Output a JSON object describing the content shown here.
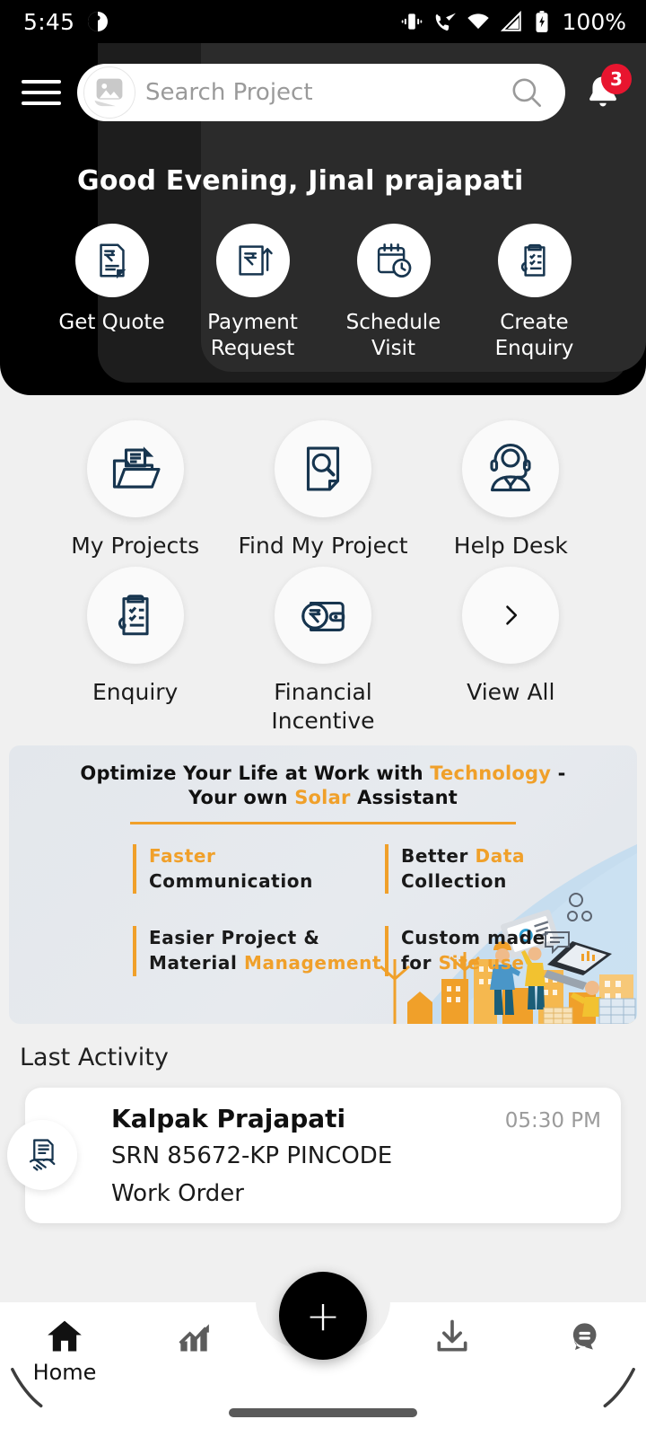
{
  "statusbar": {
    "time": "5:45",
    "battery_percent": "100%",
    "icons": [
      "vibrate-icon",
      "call-wifi-icon",
      "wifi-icon",
      "signal-icon",
      "battery-charging-icon"
    ]
  },
  "header": {
    "menu_icon": "hamburger-icon",
    "search": {
      "placeholder": "Search Project",
      "value": "",
      "avatar_icon": "image-placeholder-icon",
      "search_icon": "search-icon"
    },
    "notification": {
      "icon": "bell-icon",
      "badge_count": "3"
    },
    "greeting": "Good Evening, Jinal prajapati",
    "quick_actions": [
      {
        "label": "Get Quote",
        "icon": "invoice-rupee-icon"
      },
      {
        "label": "Payment Request",
        "icon": "payment-request-icon"
      },
      {
        "label": "Schedule Visit",
        "icon": "calendar-clock-icon"
      },
      {
        "label": "Create Enquiry",
        "icon": "clipboard-check-icon"
      }
    ]
  },
  "menu_grid": [
    {
      "label": "My Projects",
      "icon": "folder-documents-icon"
    },
    {
      "label": "Find My Project",
      "icon": "document-search-icon"
    },
    {
      "label": "Help Desk",
      "icon": "headset-agent-icon"
    },
    {
      "label": "Enquiry",
      "icon": "clipboard-check-icon"
    },
    {
      "label": "Financial Incentive",
      "icon": "wallet-rupee-icon"
    },
    {
      "label": "View All",
      "icon": "chevron-right-icon"
    }
  ],
  "banner": {
    "headline_1": "Optimize Your Life at Work with ",
    "headline_1_accent": "Technology",
    "headline_1_tail": " -",
    "headline_2_pre": "Your own ",
    "headline_2_accent": "Solar",
    "headline_2_tail": " Assistant",
    "features": [
      {
        "line1": "Faster",
        "line1_accent": true,
        "line2": "Communication",
        "line2_accent": false
      },
      {
        "line1": "Better ",
        "line1_accent": false,
        "line1_accent_text": "Data",
        "line2": "Collection",
        "line2_accent": false
      },
      {
        "line1": "Easier Project &",
        "line1_accent": false,
        "line2": "Material ",
        "line2_accent_text": "Management"
      },
      {
        "line1": "Custom made",
        "line1_accent": false,
        "line2": "for ",
        "line2_accent_text": "Site use"
      }
    ],
    "accent_color": "#f0a02a",
    "background_color": "#e4e8ed",
    "illustration": "solar-worksite-illustration"
  },
  "last_activity": {
    "section_title": "Last Activity",
    "items": [
      {
        "icon": "document-handshake-icon",
        "name": "Kalpak  Prajapati",
        "time": "05:30 PM",
        "reference": "SRN 85672-KP PINCODE",
        "type": "Work Order"
      }
    ]
  },
  "bottom_nav": {
    "items": [
      {
        "label": "Home",
        "icon": "home-icon",
        "active": true
      },
      {
        "label": "",
        "icon": "analytics-chart-icon",
        "active": false
      },
      {
        "label": "",
        "icon": "download-icon",
        "active": false
      },
      {
        "label": "",
        "icon": "chat-bubble-icon",
        "active": false
      }
    ],
    "fab": {
      "label": "+",
      "icon": "plus-icon"
    }
  }
}
